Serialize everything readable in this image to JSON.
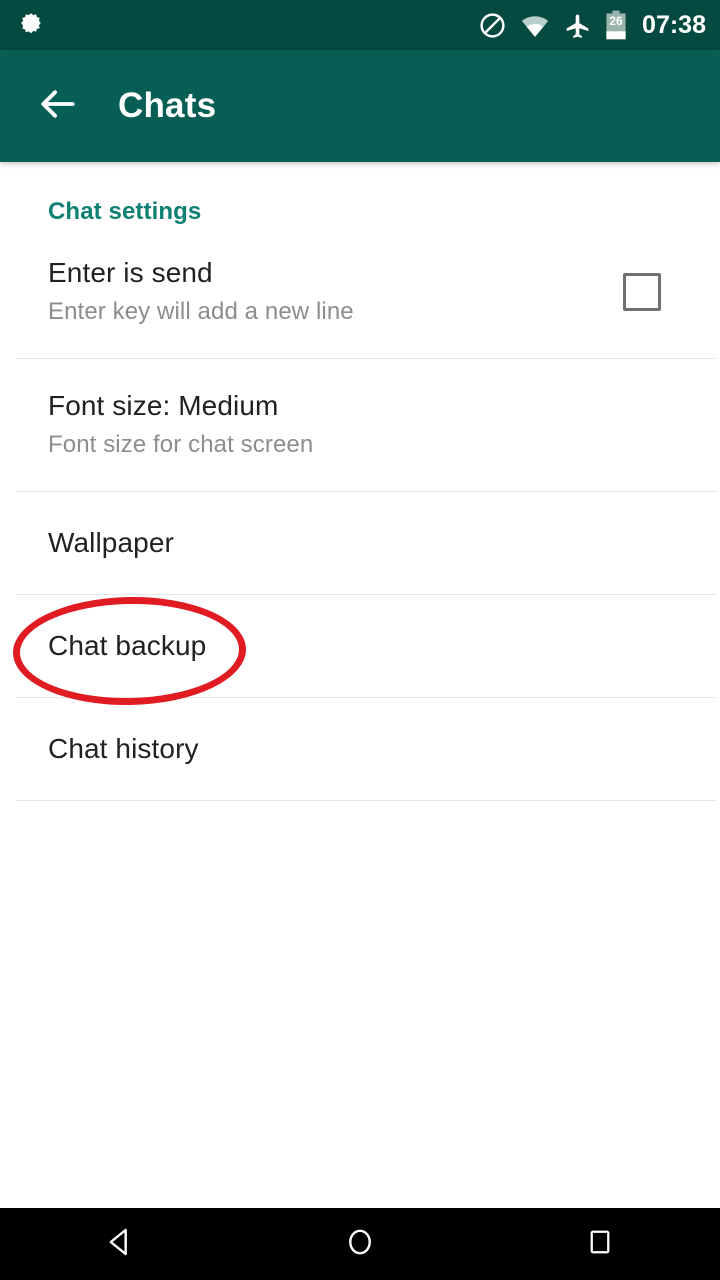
{
  "status_bar": {
    "background": "#054a40",
    "notification_icon": "settings-gear-icon",
    "icons": [
      {
        "name": "do-not-disturb-icon"
      },
      {
        "name": "wifi-icon"
      },
      {
        "name": "airplane-mode-icon"
      },
      {
        "name": "battery-icon"
      }
    ],
    "battery_level": "26",
    "time": "07:38"
  },
  "app_bar": {
    "background": "#075e54",
    "back_icon": "arrow-left-icon",
    "title": "Chats"
  },
  "content": {
    "section_header": "Chat settings",
    "items": [
      {
        "title": "Enter is send",
        "subtitle": "Enter key will add a new line",
        "control": "checkbox",
        "checked": false
      },
      {
        "title": "Font size: Medium",
        "subtitle": "Font size for chat screen",
        "control": "none"
      },
      {
        "title": "Wallpaper",
        "subtitle": "",
        "control": "none"
      },
      {
        "title": "Chat backup",
        "subtitle": "",
        "control": "none",
        "annotated": true
      },
      {
        "title": "Chat history",
        "subtitle": "",
        "control": "none"
      }
    ]
  },
  "annotation": {
    "shape": "ellipse",
    "color": "#e01b22",
    "target": "Chat backup"
  },
  "nav_bar": {
    "background": "#000000",
    "buttons": [
      {
        "name": "back-triangle-icon"
      },
      {
        "name": "home-circle-icon"
      },
      {
        "name": "recents-square-icon"
      }
    ]
  }
}
